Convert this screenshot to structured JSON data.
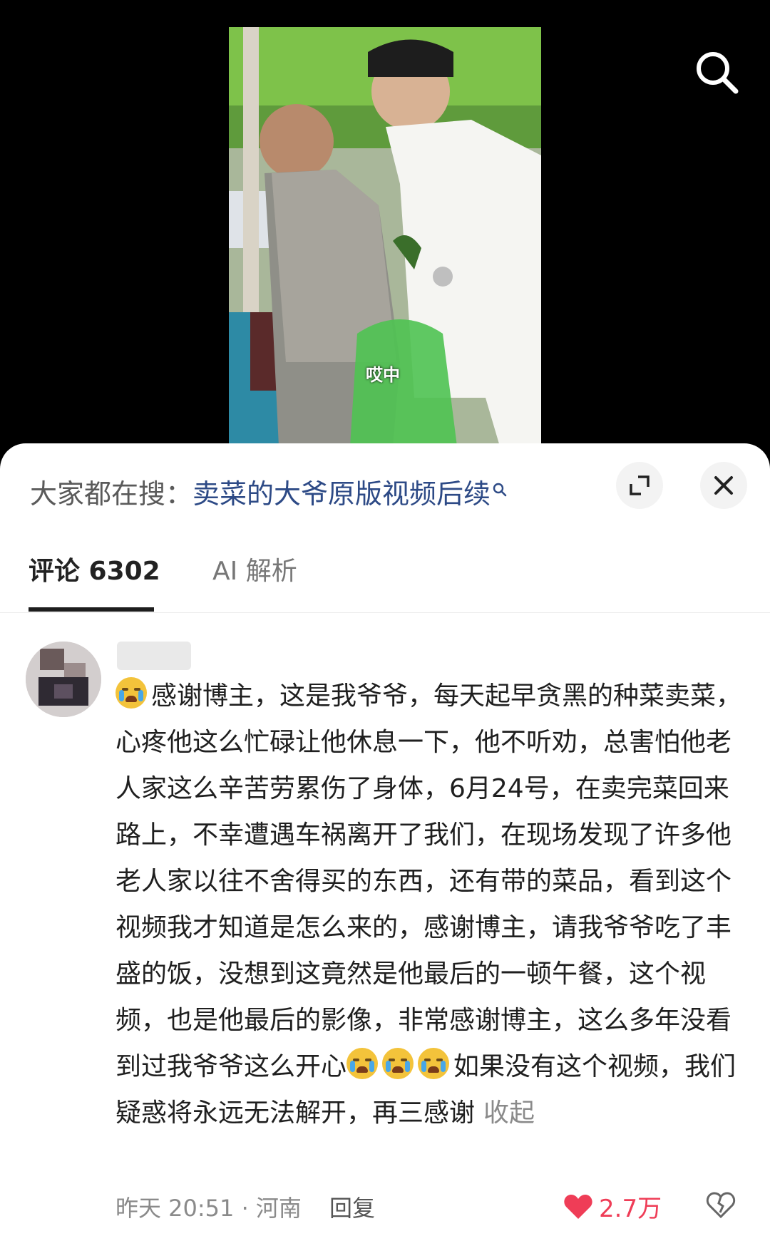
{
  "video": {
    "caption": "哎中"
  },
  "top_bar": {
    "search_icon": "search-icon"
  },
  "hot_search": {
    "prefix": "大家都在搜：",
    "query": "卖菜的大爷原版视频后续"
  },
  "tabs": [
    {
      "label": "评论 6302",
      "active": true
    },
    {
      "label": "AI 解析",
      "active": false
    }
  ],
  "comment": {
    "segments": [
      "感谢博主，这是我爷爷，每天起早贪黑的种菜卖菜，心疼他这么忙碌让他休息一下，他不听劝，总害怕他老人家这么辛苦劳累伤了身体，6月24号，在卖完菜回来路上，不幸遭遇车祸离开了我们，在现场发现了许多他老人家以往不舍得买的东西，还有带的菜品，看到这个视频我才知道是怎么来的，感谢博主，请我爷爷吃了丰盛的饭，没想到这竟然是他最后的一顿午餐，这个视频，也是他最后的影像，非常感谢博主，这么多年没看到过我爷爷这么开心",
      "如果没有这个视频，我们疑惑将永远无法解开，再三感谢"
    ],
    "collapse_label": "收起",
    "time_location": "昨天 20:51 · 河南",
    "reply_label": "回复",
    "like_count": "2.7万",
    "colors": {
      "like": "#ef3d57",
      "link": "#2d4a86"
    }
  }
}
